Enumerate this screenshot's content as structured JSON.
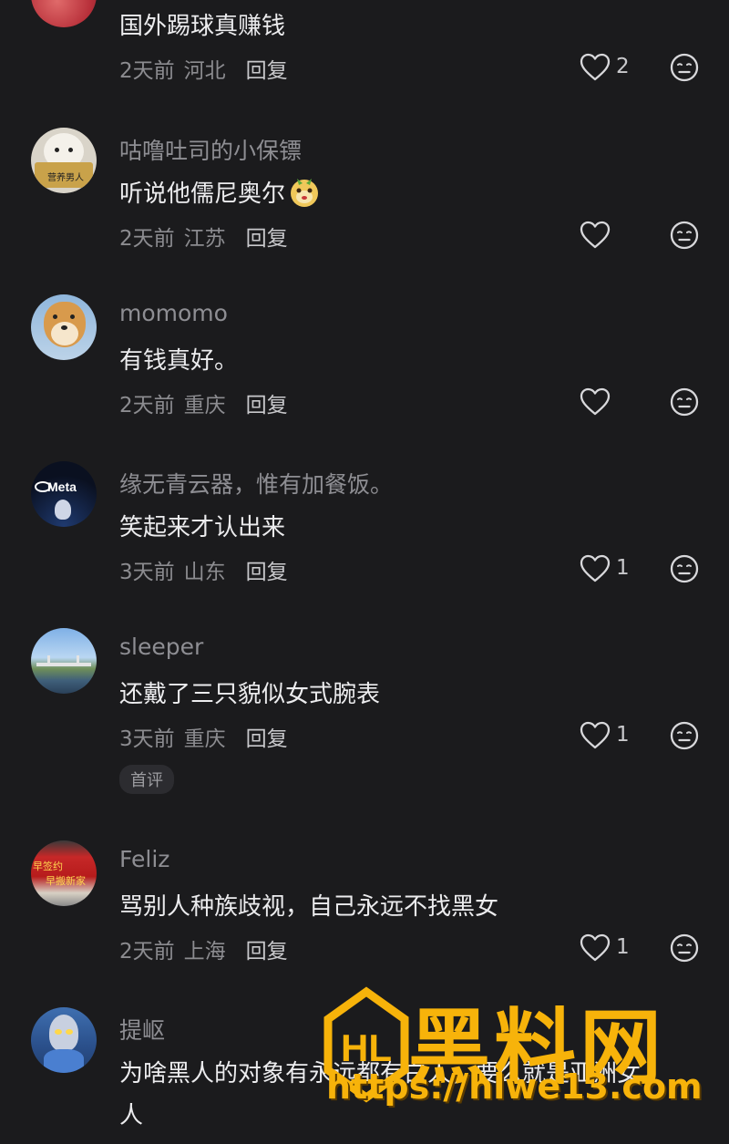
{
  "comments": [
    {
      "username": "",
      "text": "国外踢球真赚钱",
      "time": "2天前",
      "location": "河北",
      "reply": "回复",
      "likes": "2"
    },
    {
      "username": "咕噜吐司的小保镖",
      "text": "听说他儒尼奥尔",
      "time": "2天前",
      "location": "江苏",
      "reply": "回复",
      "likes": ""
    },
    {
      "username": "momomo",
      "text": "有钱真好。",
      "time": "2天前",
      "location": "重庆",
      "reply": "回复",
      "likes": ""
    },
    {
      "username": "缘无青云器，惟有加餐饭。",
      "text": "笑起来才认出来",
      "time": "3天前",
      "location": "山东",
      "reply": "回复",
      "likes": "1"
    },
    {
      "username": "sleeper",
      "text": "还戴了三只貌似女式腕表",
      "time": "3天前",
      "location": "重庆",
      "reply": "回复",
      "likes": "1",
      "badge": "首评"
    },
    {
      "username": "Feliz",
      "text": "骂别人种族歧视，自己永远不找黑女",
      "time": "2天前",
      "location": "上海",
      "reply": "回复",
      "likes": "1"
    },
    {
      "username": "提岖",
      "text": "为啥黑人的对象有永远都有白人，要么就是亚洲女",
      "text2": "人",
      "time": "",
      "location": "",
      "reply": "",
      "likes": ""
    }
  ],
  "avatars": {
    "a2_label": "营养男人",
    "a4_label": "Meta",
    "a6_label1": "早签约",
    "a6_label2": "早搬新家"
  },
  "watermark": {
    "logo": "HL",
    "title": "黑料网",
    "url": "https://hlwe13.com"
  },
  "icons": {
    "like": "heart-outline-icon",
    "react": "neutral-face-icon"
  },
  "colors": {
    "background": "#1b1b1d",
    "watermark": "#f7b30a"
  }
}
